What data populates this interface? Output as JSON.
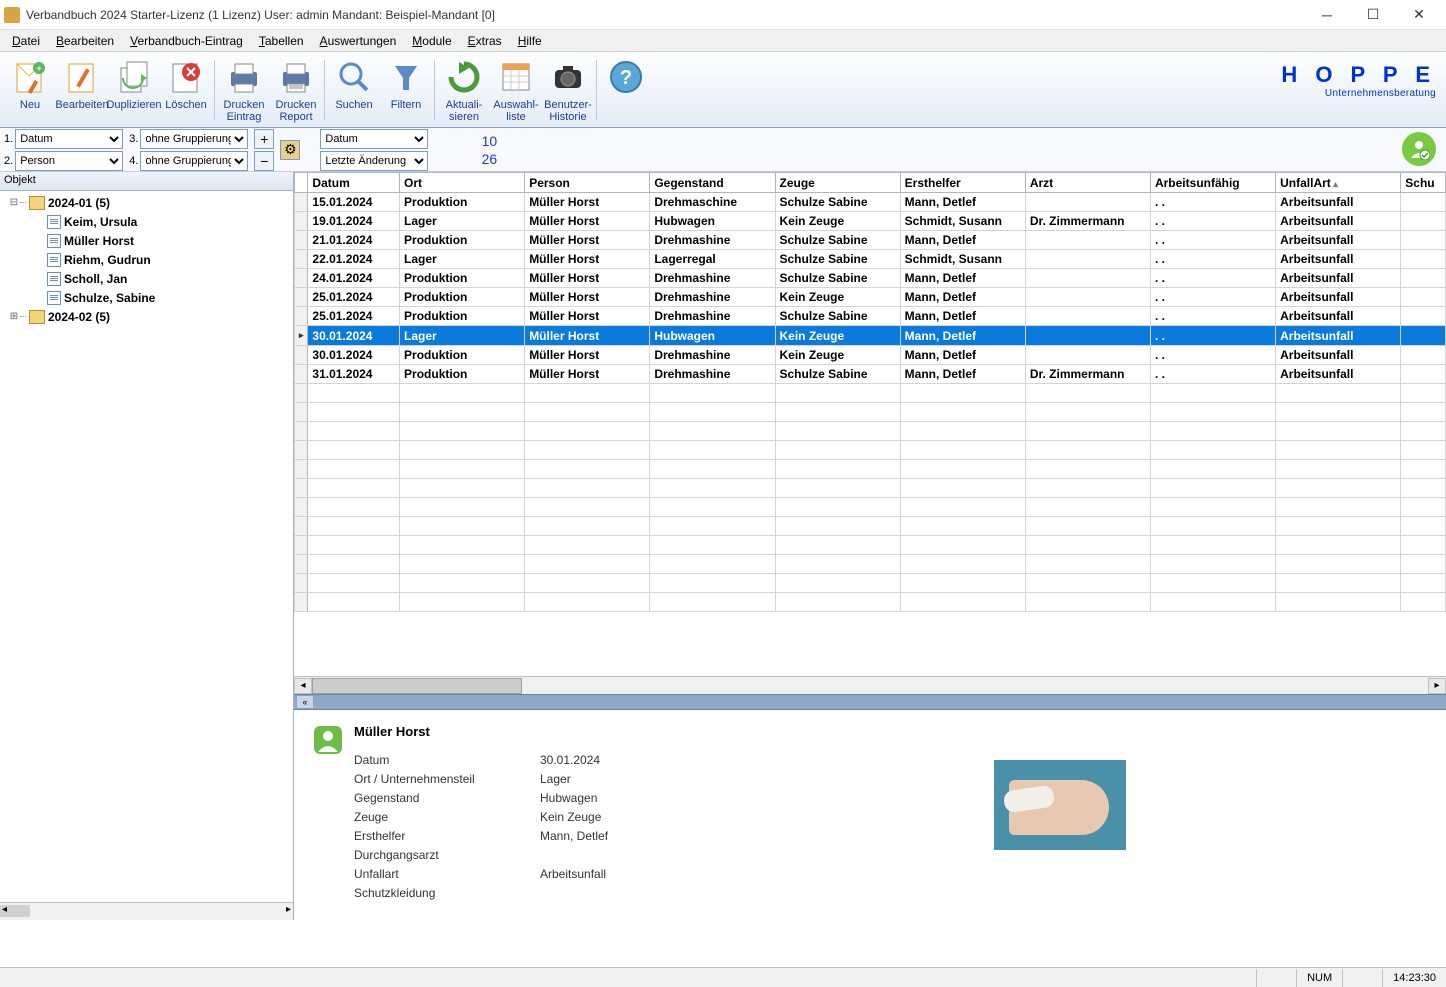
{
  "window": {
    "title": "Verbandbuch 2024 Starter-Lizenz (1 Lizenz)   User: admin Mandant: Beispiel-Mandant [0]"
  },
  "menu": {
    "datei": "Datei",
    "bearbeiten": "Bearbeiten",
    "verbandbuch": "Verbandbuch-Eintrag",
    "tabellen": "Tabellen",
    "auswertungen": "Auswertungen",
    "module": "Module",
    "extras": "Extras",
    "hilfe": "Hilfe"
  },
  "toolbar": {
    "neu": "Neu",
    "bearbeiten": "Bearbeiten",
    "duplizieren": "Duplizieren",
    "loeschen": "Löschen",
    "drucken_eintrag": "Drucken\nEintrag",
    "drucken_report": "Drucken\nReport",
    "suchen": "Suchen",
    "filtern": "Filtern",
    "aktualisieren": "Aktuali-\nsieren",
    "auswahlliste": "Auswahl-\nliste",
    "benutzerhistorie": "Benutzer-\nHistorie",
    "brand": "H O P P E",
    "brand_sub": "Unternehmensberatung"
  },
  "groupbar": {
    "l1": "1.",
    "l2": "2.",
    "l3": "3.",
    "l4": "4.",
    "sel1": "Datum",
    "sel2": "Person",
    "sel3": "ohne Gruppierung",
    "sel4": "ohne Gruppierung",
    "sort1": "Datum",
    "sort2": "Letzte Änderung",
    "count1": "10",
    "count2": "26"
  },
  "tree": {
    "header": "Objekt",
    "n1": "2024-01  (5)",
    "c1": "Keim, Ursula",
    "c2": "Müller Horst",
    "c3": "Riehm, Gudrun",
    "c4": "Scholl, Jan",
    "c5": "Schulze, Sabine",
    "n2": "2024-02  (5)"
  },
  "grid": {
    "cols": {
      "datum": "Datum",
      "ort": "Ort",
      "person": "Person",
      "gegenstand": "Gegenstand",
      "zeuge": "Zeuge",
      "ersthelfer": "Ersthelfer",
      "arzt": "Arzt",
      "arbeitsunfaehig": "Arbeitsunfähig",
      "unfallart": "UnfallArt",
      "schutz": "Schu"
    },
    "rows": [
      {
        "datum": "15.01.2024",
        "ort": "Produktion",
        "person": "Müller Horst",
        "gegenstand": "Drehmaschine",
        "zeuge": "Schulze Sabine",
        "ersthelfer": "Mann, Detlef",
        "arzt": "",
        "au": "  .  .",
        "unfallart": "Arbeitsunfall"
      },
      {
        "datum": "19.01.2024",
        "ort": "Lager",
        "person": "Müller Horst",
        "gegenstand": "Hubwagen",
        "zeuge": "Kein Zeuge",
        "ersthelfer": "Schmidt, Susann",
        "arzt": "Dr. Zimmermann",
        "au": "  .  .",
        "unfallart": "Arbeitsunfall"
      },
      {
        "datum": "21.01.2024",
        "ort": "Produktion",
        "person": "Müller Horst",
        "gegenstand": "Drehmashine",
        "zeuge": "Schulze Sabine",
        "ersthelfer": "Mann, Detlef",
        "arzt": "",
        "au": "  .  .",
        "unfallart": "Arbeitsunfall"
      },
      {
        "datum": "22.01.2024",
        "ort": "Lager",
        "person": "Müller Horst",
        "gegenstand": "Lagerregal",
        "zeuge": "Schulze Sabine",
        "ersthelfer": "Schmidt, Susann",
        "arzt": "",
        "au": "  .  .",
        "unfallart": "Arbeitsunfall"
      },
      {
        "datum": "24.01.2024",
        "ort": "Produktion",
        "person": "Müller Horst",
        "gegenstand": "Drehmashine",
        "zeuge": "Schulze Sabine",
        "ersthelfer": "Mann, Detlef",
        "arzt": "",
        "au": "  .  .",
        "unfallart": "Arbeitsunfall"
      },
      {
        "datum": "25.01.2024",
        "ort": "Produktion",
        "person": "Müller Horst",
        "gegenstand": "Drehmashine",
        "zeuge": "Kein Zeuge",
        "ersthelfer": "Mann, Detlef",
        "arzt": "",
        "au": "  .  .",
        "unfallart": "Arbeitsunfall"
      },
      {
        "datum": "25.01.2024",
        "ort": "Produktion",
        "person": "Müller Horst",
        "gegenstand": "Drehmashine",
        "zeuge": "Schulze Sabine",
        "ersthelfer": "Mann, Detlef",
        "arzt": "",
        "au": "  .  .",
        "unfallart": "Arbeitsunfall"
      },
      {
        "datum": "30.01.2024",
        "ort": "Lager",
        "person": "Müller Horst",
        "gegenstand": "Hubwagen",
        "zeuge": "Kein Zeuge",
        "ersthelfer": "Mann, Detlef",
        "arzt": "",
        "au": "  .  .",
        "unfallart": "Arbeitsunfall",
        "sel": true
      },
      {
        "datum": "30.01.2024",
        "ort": "Produktion",
        "person": "Müller Horst",
        "gegenstand": "Drehmashine",
        "zeuge": "Kein Zeuge",
        "ersthelfer": "Mann, Detlef",
        "arzt": "",
        "au": "  .  .",
        "unfallart": "Arbeitsunfall"
      },
      {
        "datum": "31.01.2024",
        "ort": "Produktion",
        "person": "Müller Horst",
        "gegenstand": "Drehmashine",
        "zeuge": "Schulze Sabine",
        "ersthelfer": "Mann, Detlef",
        "arzt": "Dr. Zimmermann",
        "au": "  .  .",
        "unfallart": "Arbeitsunfall"
      }
    ]
  },
  "details": {
    "name": "Müller Horst",
    "k_datum": "Datum",
    "v_datum": "30.01.2024",
    "k_ort": "Ort / Unternehmensteil",
    "v_ort": "Lager",
    "k_gegenstand": "Gegenstand",
    "v_gegenstand": "Hubwagen",
    "k_zeuge": "Zeuge",
    "v_zeuge": "Kein Zeuge",
    "k_ersthelfer": "Ersthelfer",
    "v_ersthelfer": "Mann, Detlef",
    "k_arzt": "Durchgangsarzt",
    "v_arzt": "",
    "k_unfallart": "Unfallart",
    "v_unfallart": "Arbeitsunfall",
    "k_schutz": "Schutzkleidung",
    "v_schutz": ""
  },
  "status": {
    "num": "NUM",
    "time": "14:23:30"
  }
}
